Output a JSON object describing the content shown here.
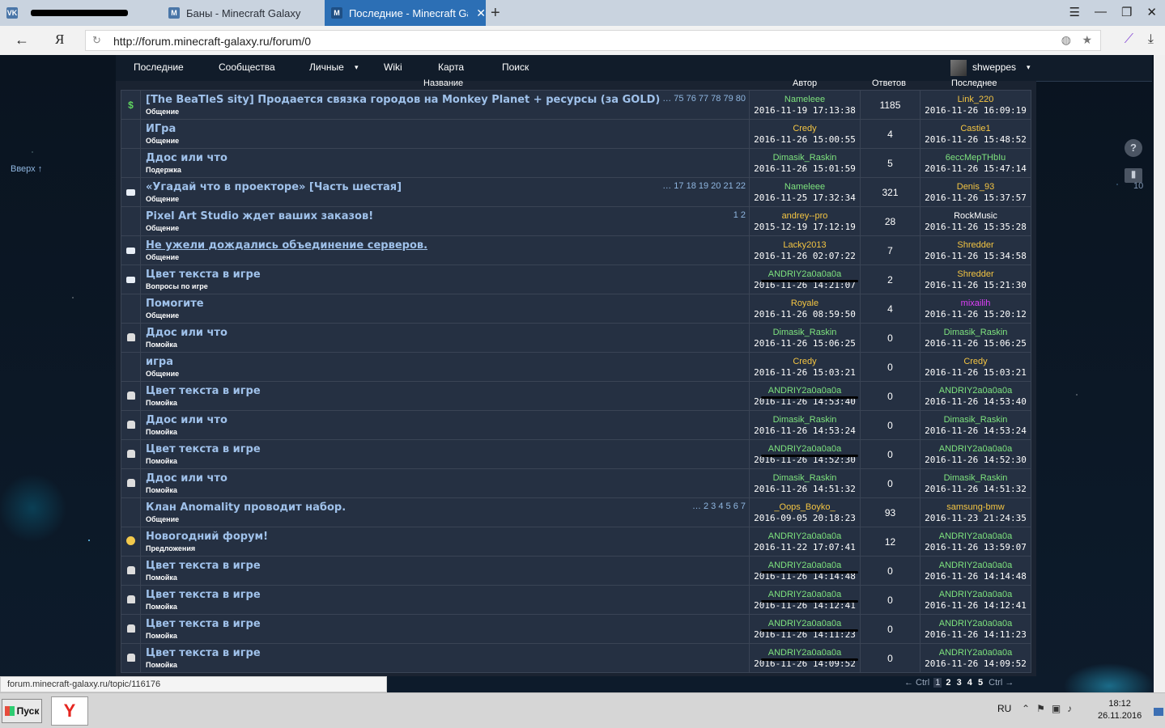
{
  "browser": {
    "tabs": [
      {
        "label": "",
        "icon": "vk-icon",
        "redacted": true
      },
      {
        "label": "Баны - Minecraft Galaxy",
        "icon": "minecraft-galaxy-icon"
      },
      {
        "label": "Последние - Minecraft Ga",
        "icon": "minecraft-galaxy-icon",
        "active": true
      }
    ],
    "new_tab": "+",
    "url": "http://forum.minecraft-galaxy.ru/forum/0",
    "yandex_letter": "Я"
  },
  "nav": {
    "items": [
      "Последние",
      "Сообщества",
      "Личные",
      "Wiki",
      "Карта",
      "Поиск"
    ],
    "user": "shweppes",
    "dropdown_glyph": "▾"
  },
  "table": {
    "headers": {
      "title": "Название",
      "author": "Автор",
      "replies": "Ответов",
      "last": "Последнее"
    },
    "rows": [
      {
        "icon": "money",
        "title": "[The BeaTleS sity] Продается связка городов на Monkey Planet + ресурсы (за GOLD)",
        "category": "Общение",
        "pages": "… 75 76 77 78 79 80",
        "author": "Nameleee",
        "author_color": "#7ee37e",
        "created": "2016-11-19 17:13:38",
        "replies": "1185",
        "last_user": "Link_220",
        "last_color": "#f4c542",
        "last_time": "2016-11-26 16:09:19"
      },
      {
        "icon": "",
        "title": "ИГра",
        "category": "Общение",
        "pages": "",
        "author": "Credy",
        "author_color": "#f4c542",
        "created": "2016-11-26 15:00:55",
        "replies": "4",
        "last_user": "Castie1",
        "last_color": "#f4c542",
        "last_time": "2016-11-26 15:48:52"
      },
      {
        "icon": "",
        "title": "Ддос или что",
        "category": "Подержка",
        "pages": "",
        "author": "Dimasik_Raskin",
        "author_color": "#7ee37e",
        "created": "2016-11-26 15:01:59",
        "replies": "5",
        "last_user": "6eccMepTHbIu",
        "last_color": "#7ee37e",
        "last_time": "2016-11-26 15:47:14"
      },
      {
        "icon": "bubble",
        "title": "«Угадай что в проекторе» [Часть шестая]",
        "category": "Общение",
        "pages": "… 17 18 19 20 21 22",
        "author": "Nameleee",
        "author_color": "#7ee37e",
        "created": "2016-11-25 17:32:34",
        "replies": "321",
        "last_user": "Denis_93",
        "last_color": "#f4c542",
        "last_time": "2016-11-26 15:37:57"
      },
      {
        "icon": "",
        "title": "Pixel Art Studio ждет ваших заказов!",
        "category": "Общение",
        "pages": "1 2",
        "author": "andrey--pro",
        "author_color": "#f4c542",
        "created": "2015-12-19 17:12:19",
        "replies": "28",
        "last_user": "RockMusic",
        "last_color": "#ffffff",
        "last_time": "2016-11-26 15:35:28"
      },
      {
        "icon": "bubble",
        "title": "Не ужели дождались объединение серверов.",
        "category": "Общение",
        "pages": "",
        "underline": true,
        "author": "Lacky2013",
        "author_color": "#f4c542",
        "created": "2016-11-26 02:07:22",
        "replies": "7",
        "last_user": "Shredder",
        "last_color": "#f4c542",
        "last_time": "2016-11-26 15:34:58"
      },
      {
        "icon": "bubble",
        "title": "Цвет текста в игре",
        "category": "Вопросы по игре",
        "pages": "",
        "author": "ANDRIY2a0a0a0a",
        "author_color": "#7ee37e",
        "created": "2016-11-26 14:21:07",
        "redact": true,
        "replies": "2",
        "last_user": "Shredder",
        "last_color": "#f4c542",
        "last_time": "2016-11-26 15:21:30"
      },
      {
        "icon": "",
        "title": "Помогите",
        "category": "Общение",
        "pages": "",
        "author": "Royale",
        "author_color": "#f4c542",
        "created": "2016-11-26 08:59:50",
        "replies": "4",
        "last_user": "mixailih",
        "last_color": "#e040fb",
        "last_time": "2016-11-26 15:20:12"
      },
      {
        "icon": "trash",
        "title": "Ддос или что",
        "category": "Помойка",
        "pages": "",
        "author": "Dimasik_Raskin",
        "author_color": "#7ee37e",
        "created": "2016-11-26 15:06:25",
        "replies": "0",
        "last_user": "Dimasik_Raskin",
        "last_color": "#7ee37e",
        "last_time": "2016-11-26 15:06:25"
      },
      {
        "icon": "",
        "title": "игра",
        "category": "Общение",
        "pages": "",
        "author": "Credy",
        "author_color": "#f4c542",
        "created": "2016-11-26 15:03:21",
        "replies": "0",
        "last_user": "Credy",
        "last_color": "#f4c542",
        "last_time": "2016-11-26 15:03:21"
      },
      {
        "icon": "trash",
        "title": "Цвет текста в игре",
        "category": "Помойка",
        "pages": "",
        "author": "ANDRIY2a0a0a0a",
        "author_color": "#7ee37e",
        "created": "2016-11-26 14:53:40",
        "redact": true,
        "replies": "0",
        "last_user": "ANDRIY2a0a0a0a",
        "last_color": "#7ee37e",
        "last_time": "2016-11-26 14:53:40"
      },
      {
        "icon": "trash",
        "title": "Ддос или что",
        "category": "Помойка",
        "pages": "",
        "author": "Dimasik_Raskin",
        "author_color": "#7ee37e",
        "created": "2016-11-26 14:53:24",
        "replies": "0",
        "last_user": "Dimasik_Raskin",
        "last_color": "#7ee37e",
        "last_time": "2016-11-26 14:53:24"
      },
      {
        "icon": "trash",
        "title": "Цвет текста в игре",
        "category": "Помойка",
        "pages": "",
        "author": "ANDRIY2a0a0a0a",
        "author_color": "#7ee37e",
        "created": "2016-11-26 14:52:30",
        "redact": true,
        "replies": "0",
        "last_user": "ANDRIY2a0a0a0a",
        "last_color": "#7ee37e",
        "last_time": "2016-11-26 14:52:30"
      },
      {
        "icon": "trash",
        "title": "Ддос или что",
        "category": "Помойка",
        "pages": "",
        "author": "Dimasik_Raskin",
        "author_color": "#7ee37e",
        "created": "2016-11-26 14:51:32",
        "replies": "0",
        "last_user": "Dimasik_Raskin",
        "last_color": "#7ee37e",
        "last_time": "2016-11-26 14:51:32"
      },
      {
        "icon": "",
        "title": "Клан Anomality проводит набор.",
        "category": "Общение",
        "pages": "… 2 3 4 5 6 7",
        "author": "_Oops_Boyko_",
        "author_color": "#f4c542",
        "created": "2016-09-05 20:18:23",
        "replies": "93",
        "last_user": "samsung-bmw",
        "last_color": "#f4c542",
        "last_time": "2016-11-23 21:24:35"
      },
      {
        "icon": "smile",
        "title": "Новогодний форум!",
        "category": "Предложения",
        "pages": "",
        "author": "ANDRIY2a0a0a0a",
        "author_color": "#7ee37e",
        "created": "2016-11-22 17:07:41",
        "replies": "12",
        "last_user": "ANDRIY2a0a0a0a",
        "last_color": "#7ee37e",
        "last_time": "2016-11-26 13:59:07"
      },
      {
        "icon": "trash",
        "title": "Цвет текста в игре",
        "category": "Помойка",
        "pages": "",
        "author": "ANDRIY2a0a0a0a",
        "author_color": "#7ee37e",
        "created": "2016-11-26 14:14:48",
        "redact": true,
        "replies": "0",
        "last_user": "ANDRIY2a0a0a0a",
        "last_color": "#7ee37e",
        "last_time": "2016-11-26 14:14:48"
      },
      {
        "icon": "trash",
        "title": "Цвет текста в игре",
        "category": "Помойка",
        "pages": "",
        "author": "ANDRIY2a0a0a0a",
        "author_color": "#7ee37e",
        "created": "2016-11-26 14:12:41",
        "redact": true,
        "replies": "0",
        "last_user": "ANDRIY2a0a0a0a",
        "last_color": "#7ee37e",
        "last_time": "2016-11-26 14:12:41"
      },
      {
        "icon": "trash",
        "title": "Цвет текста в игре",
        "category": "Помойка",
        "pages": "",
        "author": "ANDRIY2a0a0a0a",
        "author_color": "#7ee37e",
        "created": "2016-11-26 14:11:23",
        "redact": true,
        "replies": "0",
        "last_user": "ANDRIY2a0a0a0a",
        "last_color": "#7ee37e",
        "last_time": "2016-11-26 14:11:23"
      },
      {
        "icon": "trash",
        "title": "Цвет текста в игре",
        "category": "Помойка",
        "pages": "",
        "author": "ANDRIY2a0a0a0a",
        "author_color": "#7ee37e",
        "created": "2016-11-26 14:09:52",
        "redact": true,
        "replies": "0",
        "last_user": "ANDRIY2a0a0a0a",
        "last_color": "#7ee37e",
        "last_time": "2016-11-26 14:09:52"
      }
    ]
  },
  "pager": {
    "prev": "← Ctrl",
    "pages": [
      "1",
      "2",
      "3",
      "4",
      "5"
    ],
    "current": "1",
    "next": "Ctrl →"
  },
  "side": {
    "up_link": "Вверх ↑",
    "help": "?",
    "messages_count": "10"
  },
  "status_bar": "forum.minecraft-galaxy.ru/topic/116176",
  "taskbar": {
    "start": "Пуск",
    "lang": "RU",
    "time": "18:12",
    "date": "26.11.2016"
  }
}
